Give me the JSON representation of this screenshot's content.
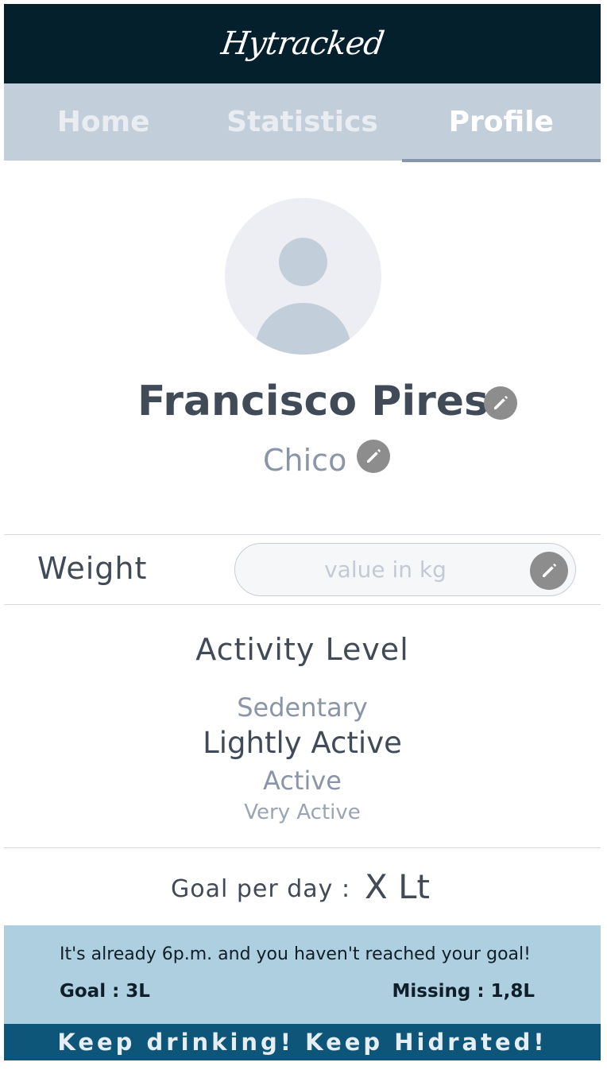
{
  "header": {
    "logo_text": "Hytracked"
  },
  "tabs": [
    {
      "label": "Home",
      "active": false
    },
    {
      "label": "Statistics",
      "active": false
    },
    {
      "label": "Profile",
      "active": true
    }
  ],
  "profile": {
    "avatar_icon": "user-avatar-icon",
    "name": "Francisco Pires",
    "nickname": "Chico",
    "edit_icon": "pencil-icon"
  },
  "weight": {
    "label": "Weight",
    "placeholder": "value in kg",
    "value": ""
  },
  "activity": {
    "title": "Activity Level",
    "options": [
      "Sedentary",
      "Lightly Active",
      "Active",
      "Very Active"
    ],
    "selected": "Lightly Active"
  },
  "goal": {
    "label": "Goal per day :",
    "value": "X Lt"
  },
  "notice": {
    "message": "It's already 6p.m. and you haven't reached your goal!",
    "goal_text": "Goal : 3L",
    "missing_text": "Missing : 1,8L"
  },
  "footer": {
    "text": "Keep drinking! Keep Hidrated!"
  },
  "colors": {
    "header_bg": "#03202c",
    "tabs_bg": "#c3cedb",
    "notice_bg": "#adcfe0",
    "footer_bg": "#0d5579",
    "edit_button": "#8d8d8d"
  }
}
